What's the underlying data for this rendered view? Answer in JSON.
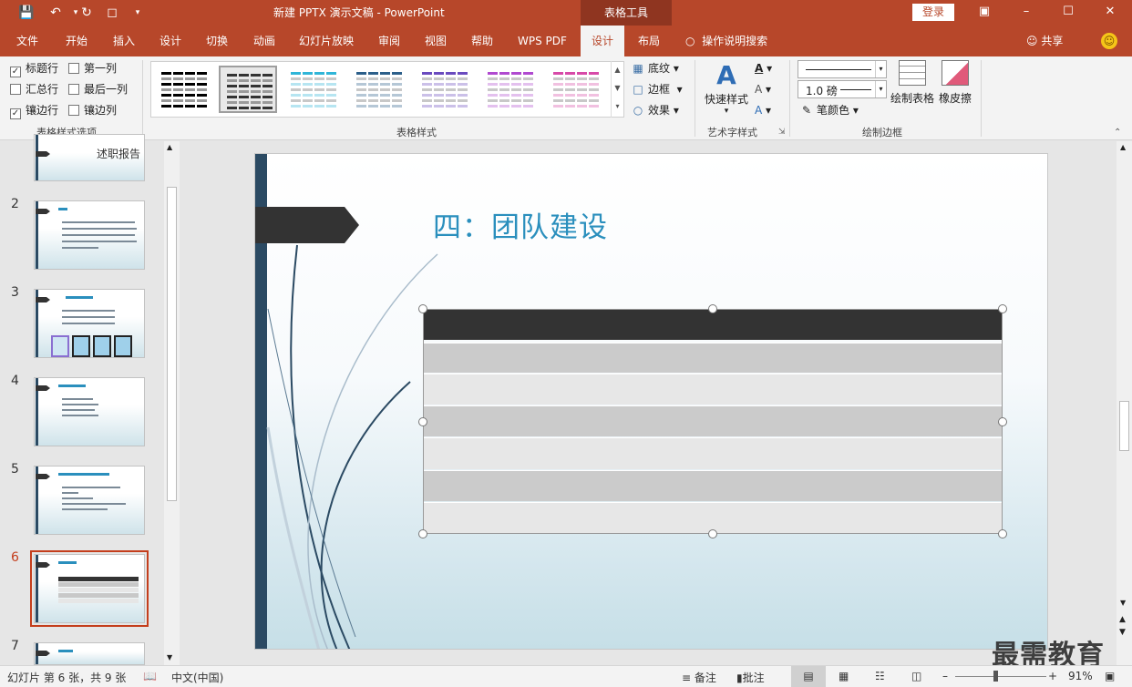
{
  "titlebar": {
    "doc_title": "新建 PPTX 演示文稿  -  PowerPoint",
    "context_tab": "表格工具",
    "login": "登录"
  },
  "tabs": [
    "文件",
    "开始",
    "插入",
    "设计",
    "切换",
    "动画",
    "幻灯片放映",
    "审阅",
    "视图",
    "帮助",
    "WPS PDF",
    "设计",
    "布局"
  ],
  "tell_me": "操作说明搜索",
  "share": "共享",
  "ribbon": {
    "style_options": {
      "label": "表格样式选项",
      "items": [
        {
          "label": "标题行",
          "checked": true
        },
        {
          "label": "第一列",
          "checked": false
        },
        {
          "label": "汇总行",
          "checked": false
        },
        {
          "label": "最后一列",
          "checked": false
        },
        {
          "label": "镶边行",
          "checked": true
        },
        {
          "label": "镶边列",
          "checked": false
        }
      ]
    },
    "table_styles": {
      "label": "表格样式",
      "colors": [
        "#000000",
        "#333333",
        "#2fb5d8",
        "#2c5f8a",
        "#6a4bbf",
        "#b04ad0",
        "#d74aa8"
      ],
      "shading": "底纹",
      "border": "边框",
      "effects": "效果"
    },
    "wordart": {
      "label": "艺术字样式",
      "quick_styles": "快速样式"
    },
    "draw_borders": {
      "label": "绘制边框",
      "pen_weight": "1.0 磅",
      "pen_color": "笔颜色",
      "draw_table": "绘制表格",
      "eraser": "橡皮擦"
    }
  },
  "slides": [
    {
      "num": "",
      "label": "述职报告"
    },
    {
      "num": "2"
    },
    {
      "num": "3"
    },
    {
      "num": "4"
    },
    {
      "num": "5"
    },
    {
      "num": "6"
    },
    {
      "num": "7"
    }
  ],
  "slide": {
    "title": "四：团队建设"
  },
  "status": {
    "slide_info": "幻灯片 第 6 张，共 9 张",
    "language": "中文(中国)",
    "notes": "备注",
    "comments": "批注",
    "zoom": "91%"
  },
  "watermark": "最需教育"
}
